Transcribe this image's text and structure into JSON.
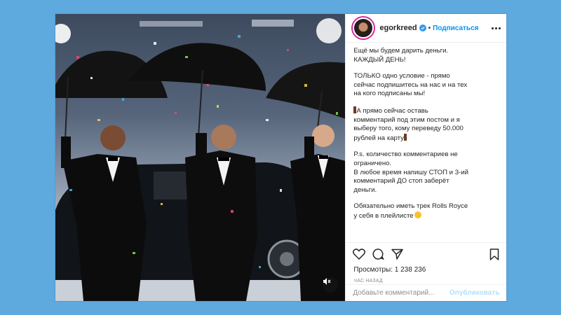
{
  "header": {
    "username": "egorkreed",
    "separator": "•",
    "follow_label": "Подписаться"
  },
  "caption": {
    "p1": "Ещё мы будем дарить деньги.\nКАЖДЫЙ ДЕНЬ!",
    "p2": "ТОЛЬКО одно условие - прямо\nсейчас подпишитесь на нас и на тех\nна кого подписаны мы!",
    "p3": "А прямо сейчас оставь\nкомментарий под этим постом и я\nвыберу того, кому переведу 50.000\nрублей на карту",
    "p4": "P.s. количество комментариев не\nограничено.\nВ любое время напишу СТОП и 3-ий\nкомментарий ДО стоп заберёт\nденьги.",
    "p5": "Обязательно иметь трек Rolls Royce\nу себя в плейлисте"
  },
  "stats": {
    "views": "Просмотры: 1 238 236",
    "time": "ЧАС НАЗАД"
  },
  "comment": {
    "placeholder": "Добавьте комментарий...",
    "post_label": "Опубликовать"
  },
  "icons": [
    "heart-icon",
    "comment-icon",
    "share-icon",
    "bookmark-icon",
    "verified-icon",
    "more-icon",
    "mute-icon"
  ],
  "colors": {
    "background": "#5ea9dd",
    "link": "#0095f6",
    "verified": "#3897f0",
    "post_disabled": "#b2dffc"
  }
}
